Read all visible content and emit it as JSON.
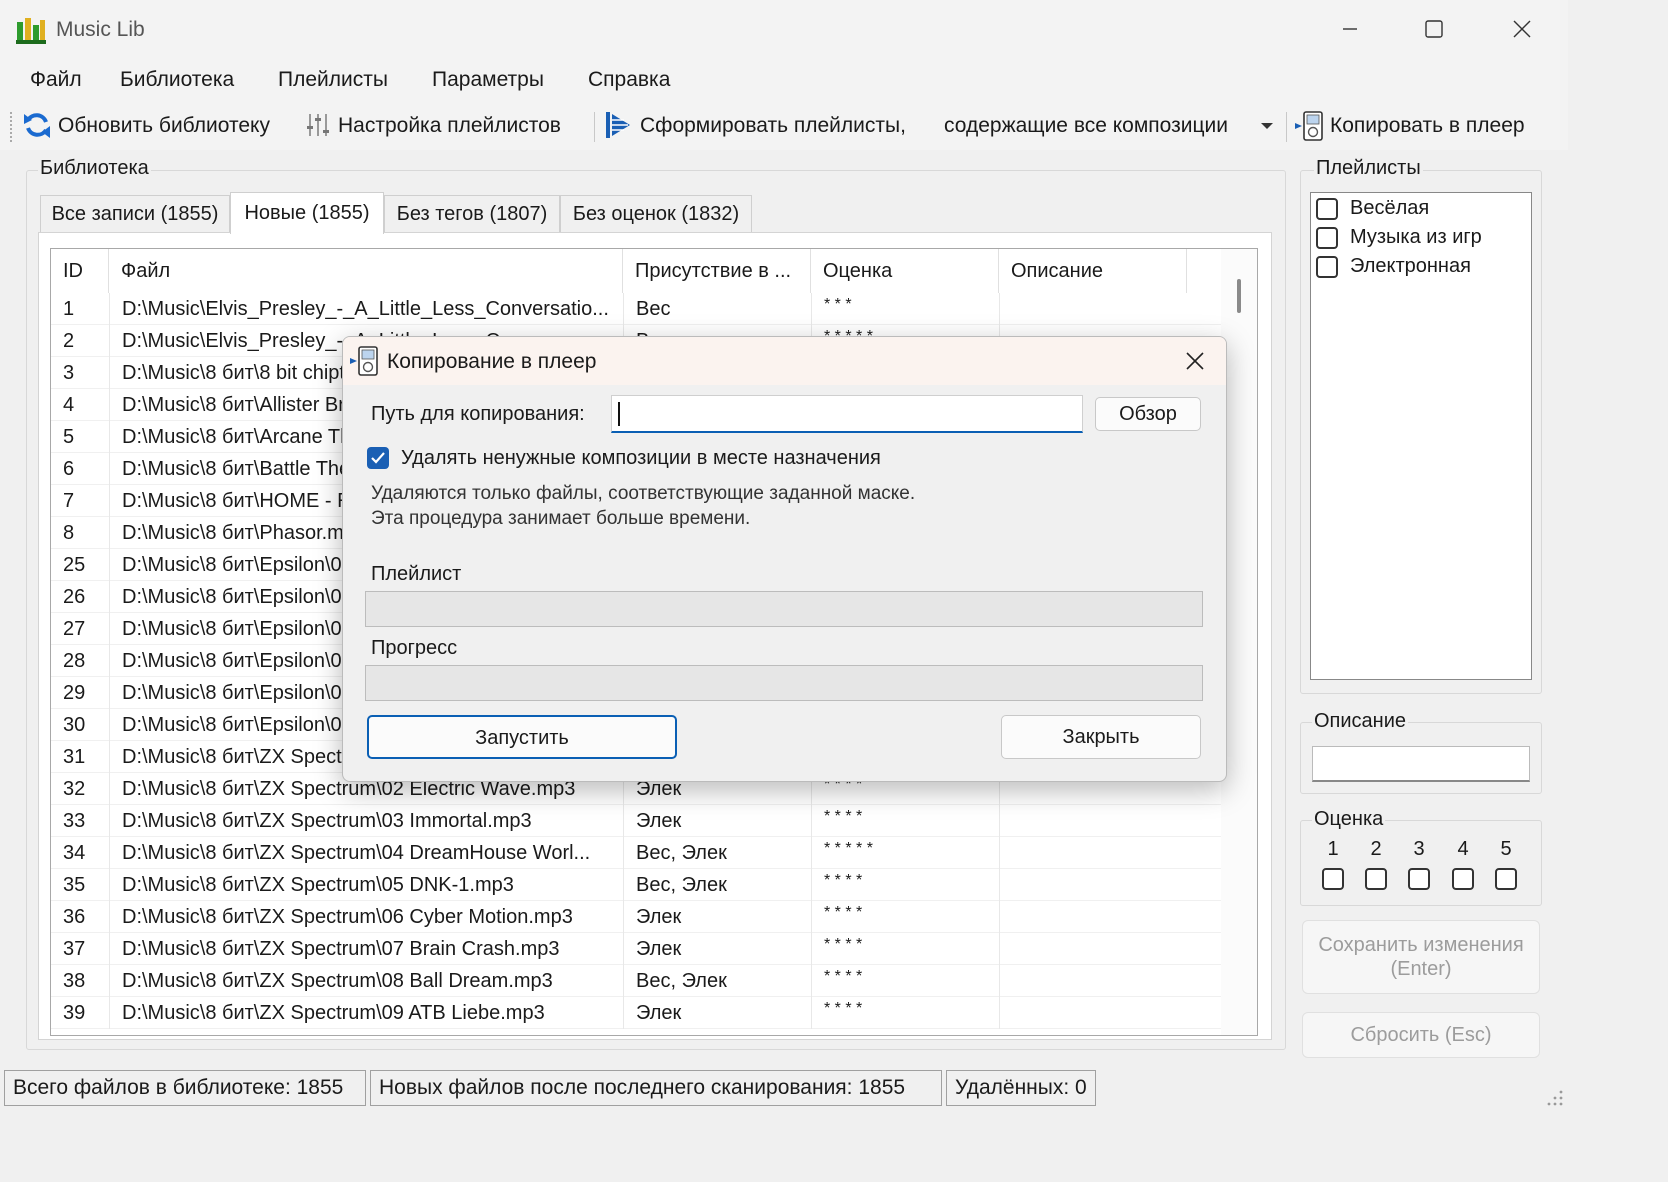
{
  "window": {
    "title": "Music Lib"
  },
  "menu": [
    "Файл",
    "Библиотека",
    "Плейлисты",
    "Параметры",
    "Справка"
  ],
  "toolbar": {
    "refresh": "Обновить библиотеку",
    "playlist_settings": "Настройка плейлистов",
    "form_playlists": "Сформировать плейлисты,",
    "mode_select": "содержащие все композиции",
    "copy_to_player": "Копировать в плеер"
  },
  "library": {
    "group_label": "Библиотека",
    "tabs": [
      "Все записи (1855)",
      "Новые (1855)",
      "Без тегов (1807)",
      "Без оценок (1832)"
    ],
    "active_tab": 1,
    "columns": [
      "ID",
      "Файл",
      "Присутствие в ...",
      "Оценка",
      "Описание"
    ],
    "rows": [
      [
        "1",
        "D:\\Music\\Elvis_Presley_-_A_Little_Less_Conversatio...",
        "Вес",
        "* * *",
        ""
      ],
      [
        "2",
        "D:\\Music\\Elvis_Presley_-_A_Little_Less_Conv...",
        "Вес",
        "* * * * *",
        ""
      ],
      [
        "3",
        "D:\\Music\\8 бит\\8 bit chiptune.mp3",
        "",
        "",
        ""
      ],
      [
        "4",
        "D:\\Music\\8 бит\\Allister Brimble.mp3",
        "",
        "",
        ""
      ],
      [
        "5",
        "D:\\Music\\8 бит\\Arcane Theme.mp3",
        "",
        "",
        ""
      ],
      [
        "6",
        "D:\\Music\\8 бит\\Battle Theme.mp3",
        "",
        "",
        ""
      ],
      [
        "7",
        "D:\\Music\\8 бит\\HOME - Resonance.mp3",
        "",
        "",
        ""
      ],
      [
        "8",
        "D:\\Music\\8 бит\\Phasor.mp3",
        "",
        "",
        ""
      ],
      [
        "25",
        "D:\\Music\\8 бит\\Epsilon\\01.mp3",
        "",
        "",
        ""
      ],
      [
        "26",
        "D:\\Music\\8 бит\\Epsilon\\02.mp3",
        "",
        "",
        ""
      ],
      [
        "27",
        "D:\\Music\\8 бит\\Epsilon\\03.mp3",
        "",
        "",
        ""
      ],
      [
        "28",
        "D:\\Music\\8 бит\\Epsilon\\04.mp3",
        "",
        "",
        ""
      ],
      [
        "29",
        "D:\\Music\\8 бит\\Epsilon\\05.mp3",
        "",
        "",
        ""
      ],
      [
        "30",
        "D:\\Music\\8 бит\\Epsilon\\06.mp3",
        "",
        "",
        ""
      ],
      [
        "31",
        "D:\\Music\\8 бит\\ZX Spectrum\\01.mp3",
        "",
        "",
        ""
      ],
      [
        "32",
        "D:\\Music\\8 бит\\ZX Spectrum\\02 Electric Wave.mp3",
        "Элек",
        "* * * *",
        ""
      ],
      [
        "33",
        "D:\\Music\\8 бит\\ZX Spectrum\\03 Immortal.mp3",
        "Элек",
        "* * * *",
        ""
      ],
      [
        "34",
        "D:\\Music\\8 бит\\ZX Spectrum\\04 DreamHouse Worl...",
        "Вес, Элек",
        "* * * * *",
        ""
      ],
      [
        "35",
        "D:\\Music\\8 бит\\ZX Spectrum\\05 DNK-1.mp3",
        "Вес, Элек",
        "* * * *",
        ""
      ],
      [
        "36",
        "D:\\Music\\8 бит\\ZX Spectrum\\06 Cyber Motion.mp3",
        "Элек",
        "* * * *",
        ""
      ],
      [
        "37",
        "D:\\Music\\8 бит\\ZX Spectrum\\07 Brain Crash.mp3",
        "Элек",
        "* * * *",
        ""
      ],
      [
        "38",
        "D:\\Music\\8 бит\\ZX Spectrum\\08 Ball Dream.mp3",
        "Вес, Элек",
        "* * * *",
        ""
      ],
      [
        "39",
        "D:\\Music\\8 бит\\ZX Spectrum\\09 ATB Liebe.mp3",
        "Элек",
        "* * * *",
        ""
      ]
    ]
  },
  "playlists": {
    "group_label": "Плейлисты",
    "items": [
      "Весёлая",
      "Музыка из игр",
      "Электронная"
    ]
  },
  "description": {
    "group_label": "Описание",
    "value": ""
  },
  "rating": {
    "group_label": "Оценка",
    "options": [
      "1",
      "2",
      "3",
      "4",
      "5"
    ]
  },
  "buttons": {
    "save_line1": "Сохранить изменения",
    "save_line2": "(Enter)",
    "reset": "Сбросить (Esc)"
  },
  "status": {
    "total": "Всего файлов в библиотеке: 1855",
    "new": "Новых файлов после последнего сканирования: 1855",
    "deleted": "Удалённых: 0"
  },
  "dialog": {
    "title": "Копирование в плеер",
    "path_label": "Путь для копирования:",
    "path_value": "",
    "browse": "Обзор",
    "delete_checkbox_label": "Удалять ненужные композиции в месте назначения",
    "delete_checked": true,
    "note_line1": "Удаляются только файлы, соответствующие заданной маске.",
    "note_line2": "Эта процедура занимает больше времени.",
    "playlist_label": "Плейлист",
    "playlist_progress": 0,
    "progress_label": "Прогресс",
    "progress": 0,
    "start": "Запустить",
    "close": "Закрыть"
  },
  "colors": {
    "accent": "#0a5fb4",
    "checkbox": "#1a5fb4"
  }
}
